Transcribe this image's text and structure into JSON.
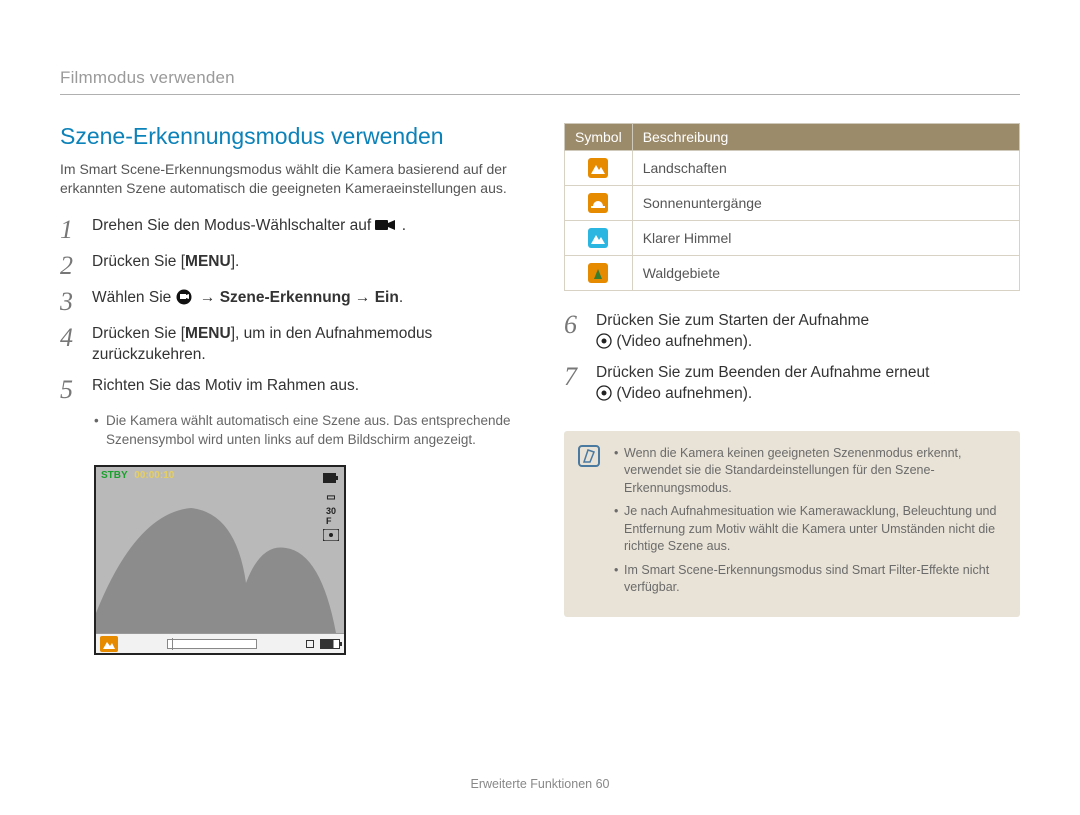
{
  "header": {
    "breadcrumb": "Filmmodus verwenden"
  },
  "section": {
    "title": "Szene-Erkennungsmodus verwenden",
    "intro": "Im Smart Scene-Erkennungsmodus wählt die Kamera basierend auf der erkannten Szene automatisch die geeigneten Kameraeinstellungen aus."
  },
  "steps_left": {
    "s1_pre": "Drehen Sie den Modus-Wählschalter auf ",
    "s1_post": ".",
    "s2_pre": "Drücken Sie [",
    "s2_post": "].",
    "s3_pre": "Wählen Sie ",
    "s3_bold": " → Szene-Erkennung → Ein",
    "s3_post": ".",
    "s4_pre": "Drücken Sie [",
    "s4_post": "], um in den Aufnahmemodus zurückzukehren.",
    "s5": "Richten Sie das Motiv im Rahmen aus.",
    "s5_bullet": "Die Kamera wählt automatisch eine Szene aus. Das entsprechende Szenensymbol wird unten links auf dem Bildschirm angezeigt."
  },
  "steps_right": {
    "s6_line1": "Drücken Sie zum Starten der Aufnahme",
    "s6_line2": " (Video aufnehmen).",
    "s7_line1": "Drücken Sie zum Beenden der Aufnahme erneut",
    "s7_line2": " (Video aufnehmen)."
  },
  "camera": {
    "stby": "STBY",
    "time": "00:00:10"
  },
  "table": {
    "hdr_symbol": "Symbol",
    "hdr_desc": "Beschreibung",
    "rows": [
      {
        "label": "Landschaften"
      },
      {
        "label": "Sonnenuntergänge"
      },
      {
        "label": "Klarer Himmel"
      },
      {
        "label": "Waldgebiete"
      }
    ]
  },
  "notes": {
    "n0": "Wenn die Kamera keinen geeigneten Szenenmodus erkennt, verwendet sie die Standardeinstellungen für den Szene-Erkennungsmodus.",
    "n1": "Je nach Aufnahmesituation wie Kamerawacklung, Beleuchtung und Entfernung zum Motiv wählt die Kamera unter Umständen nicht die richtige Szene aus.",
    "n2": "Im Smart Scene-Erkennungsmodus sind Smart Filter-Effekte nicht verfügbar."
  },
  "footer": {
    "text": "Erweiterte Funktionen  60"
  },
  "icons": {
    "mode_dial": "video-mode-dial-icon",
    "menu": "MENU",
    "video_gear": "video-settings-icon",
    "record": "record-button-icon"
  }
}
